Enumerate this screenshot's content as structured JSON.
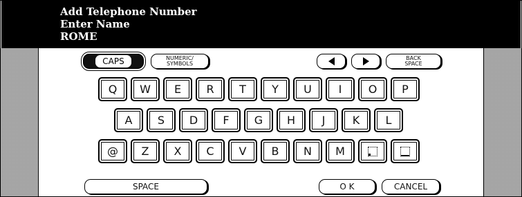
{
  "header": {
    "line1": "Add Telephone Number",
    "line2": "Enter Name",
    "line3": "ROME"
  },
  "toolbar": {
    "caps": "CAPS",
    "numeric_line1": "NUMERIC/",
    "numeric_line2": "SYMBOLS",
    "back_line1": "BACK",
    "back_line2": "SPACE"
  },
  "keys": {
    "row1": [
      "Q",
      "W",
      "E",
      "R",
      "T",
      "Y",
      "U",
      "I",
      "O",
      "P"
    ],
    "row2": [
      "A",
      "S",
      "D",
      "F",
      "G",
      "H",
      "J",
      "K",
      "L"
    ],
    "row3": [
      "@",
      "Z",
      "X",
      "C",
      "V",
      "B",
      "N",
      "M"
    ]
  },
  "bottom": {
    "space": "SPACE",
    "ok": "O K",
    "cancel": "CANCEL"
  },
  "icons": {
    "cursor_left": "left-arrow-icon",
    "cursor_right": "right-arrow-icon",
    "special1": "dotted-box-period-icon",
    "special2": "dotted-box-underscore-icon"
  },
  "colors": {
    "header_bg": "#000000",
    "header_text": "#ffffff",
    "panel": "#c4c4c4"
  }
}
